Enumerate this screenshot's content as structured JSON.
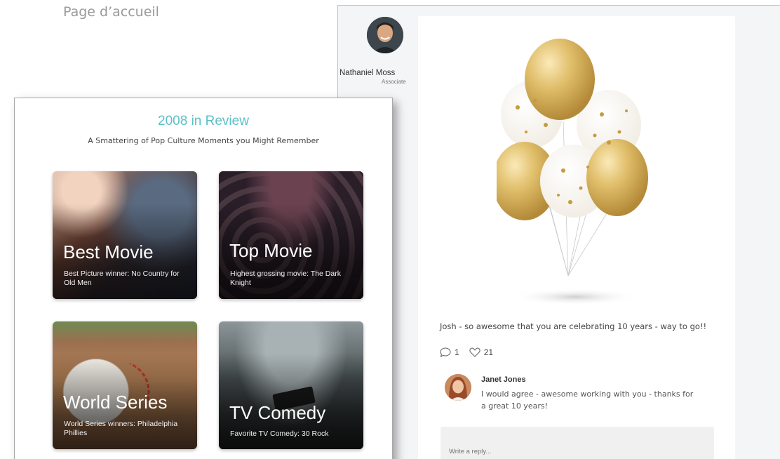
{
  "page_label": "Page d’accueil",
  "post": {
    "author_name": "Nathaniel Moss",
    "author_role": "Associate",
    "text": "Josh - so awesome that you are celebrating 10 years - way to go!!",
    "comment_count": "1",
    "like_count": "21",
    "reply": {
      "name": "Janet Jones",
      "text": "I would agree - awesome working with you - thanks for a great 10 years!"
    },
    "reply_placeholder": "Write a reply..."
  },
  "review": {
    "title": "2008 in Review",
    "subtitle": "A Smattering of Pop Culture Moments you Might Remember",
    "tiles": [
      {
        "title": "Best Movie",
        "desc": "Best Picture winner: No Country for Old Men"
      },
      {
        "title": "Top Movie",
        "desc": "Highest grossing movie: The Dark Knight"
      },
      {
        "title": "World Series",
        "desc": "World Series winners: Philadelphia Phillies"
      },
      {
        "title": "TV Comedy",
        "desc": "Favorite TV Comedy: 30 Rock"
      }
    ]
  },
  "icons": {
    "comment": "comment-icon",
    "like": "heart-icon"
  },
  "colors": {
    "accent_title": "#5bc0c6",
    "balloon_gold": "#d9b25c"
  }
}
